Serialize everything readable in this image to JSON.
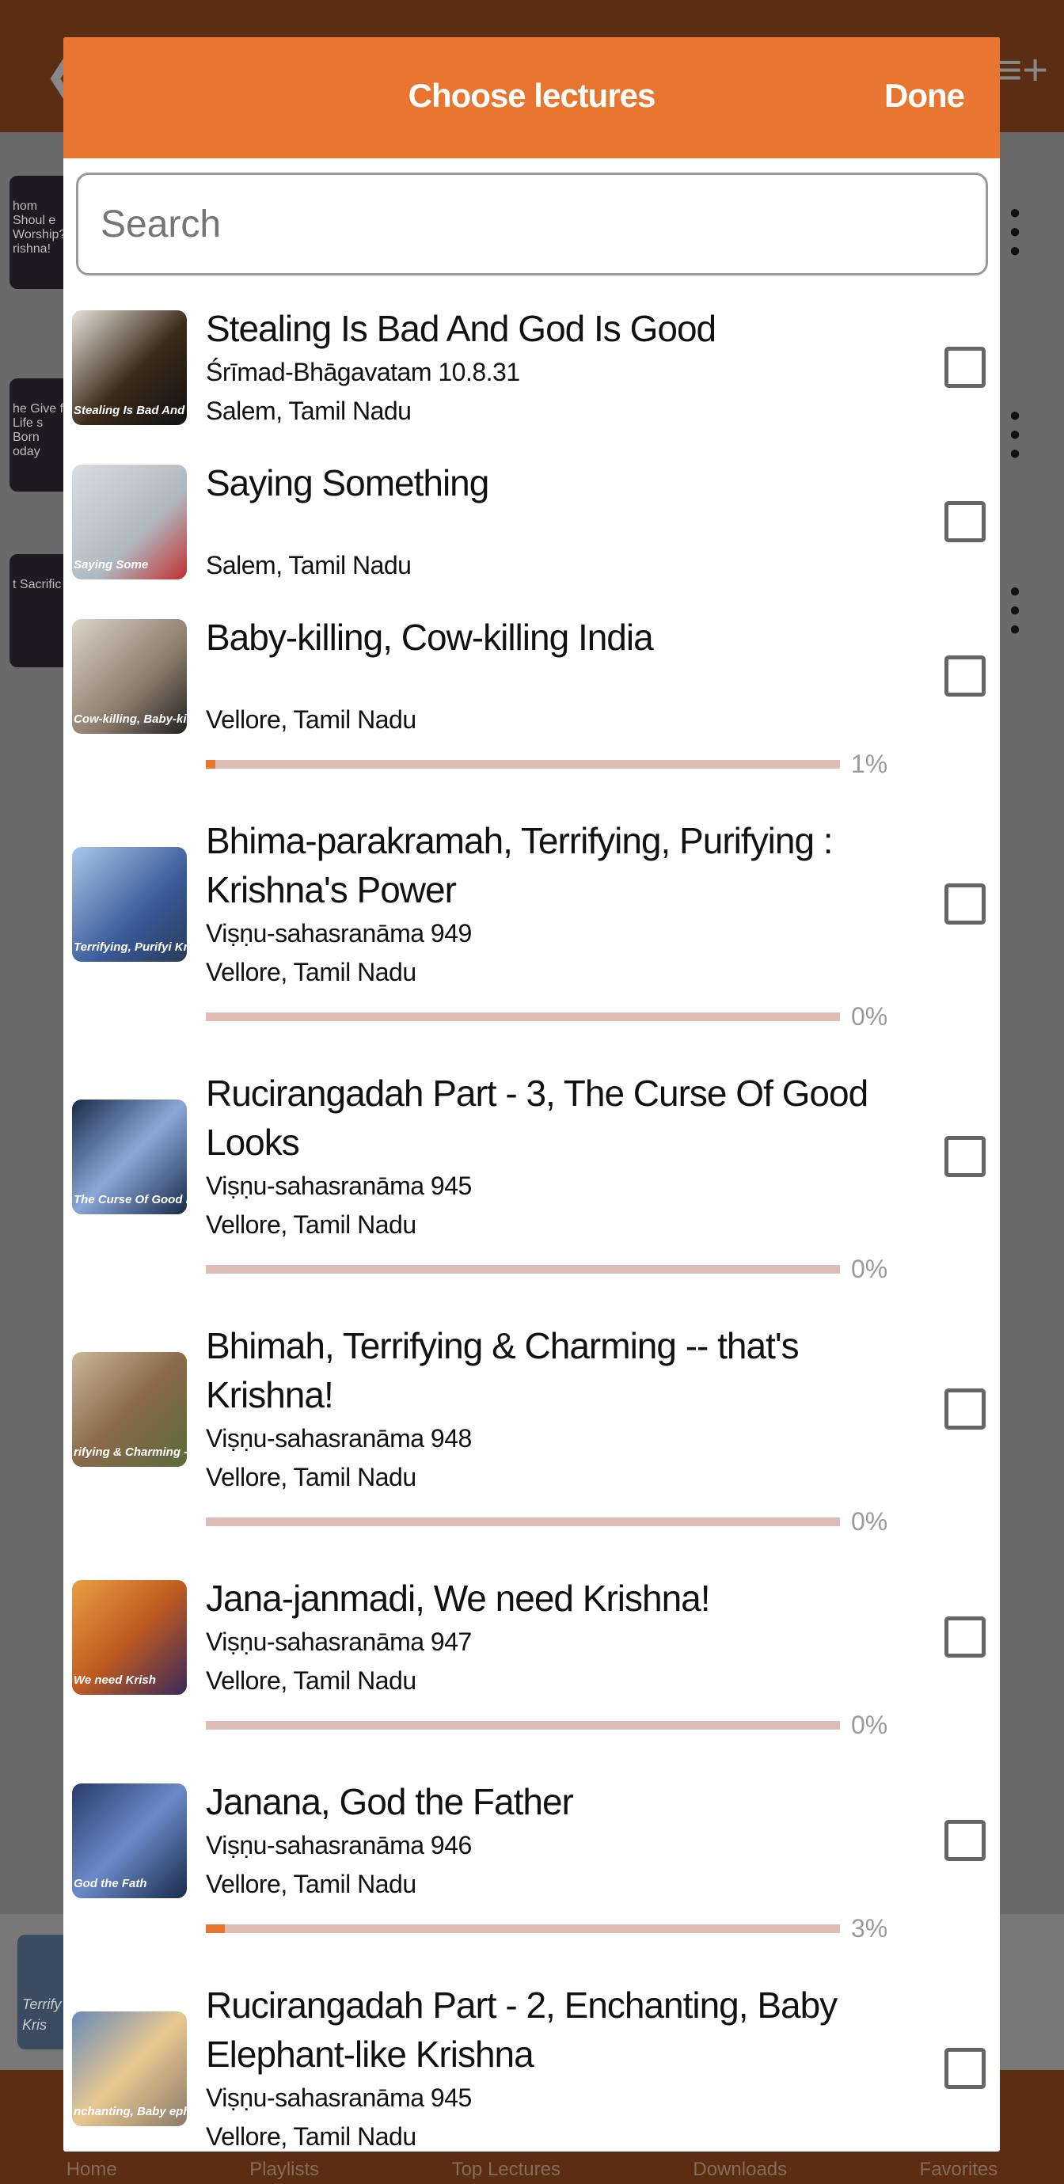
{
  "background": {
    "back_icon": "arrow-left-icon",
    "add_playlist_icon": "playlist-add-icon",
    "rows": [
      {
        "thumb_caption": "hom Shoul e Worship? rishna!"
      },
      {
        "thumb_caption": "he Give f Life s Born oday"
      },
      {
        "thumb_caption": "t Sacrific"
      }
    ],
    "mini_player_caption": "Terrify Kris",
    "nav": [
      "Home",
      "Playlists",
      "Top Lectures",
      "Downloads",
      "Favorites"
    ]
  },
  "dialog": {
    "title": "Choose lectures",
    "done_label": "Done",
    "search_placeholder": "Search",
    "accent": "#e87530",
    "items": [
      {
        "title": "Stealing Is Bad And God Is Good",
        "subtitle": "Śrīmad-Bhāgavatam 10.8.31",
        "location": "Salem, Tamil Nadu",
        "thumb_caption": "Stealing Is Bad And God Is Good",
        "checked": false,
        "progress": null,
        "thumb": "linear-gradient(135deg,#e8e2da,#3b2a1a 55%,#111)"
      },
      {
        "title": "Saying Something",
        "subtitle": "",
        "location": "Salem, Tamil Nadu",
        "thumb_caption": "Saying Some",
        "checked": false,
        "progress": null,
        "thumb": "linear-gradient(135deg,#d8dde2,#b0b8c0 60%,#c03030)"
      },
      {
        "title": "Baby-killing, Cow-killing India",
        "subtitle": "",
        "location": "Vellore, Tamil Nadu",
        "thumb_caption": "Cow-killing, Baby-killing",
        "checked": false,
        "progress": 1,
        "progress_label": "1%",
        "thumb": "linear-gradient(135deg,#ddd4c8,#8a7a6a 60%,#222)"
      },
      {
        "title": "Bhima-parakramah, Terrifying, Purifying : Krishna's Power",
        "subtitle": "Viṣṇu-sahasranāma 949",
        "location": "Vellore, Tamil Nadu",
        "thumb_caption": "Terrifying, Purifyi Krishna's Powe",
        "checked": false,
        "progress": 0,
        "progress_label": "0%",
        "thumb": "linear-gradient(135deg,#a8c8e8,#3a5a9a 60%,#2a3a5a)"
      },
      {
        "title": "Rucirangadah Part - 3, The Curse Of Good Looks",
        "subtitle": "Viṣṇu-sahasranāma 945",
        "location": "Vellore, Tamil Nadu",
        "thumb_caption": "The Curse Of Good L",
        "checked": false,
        "progress": 0,
        "progress_label": "0%",
        "thumb": "linear-gradient(135deg,#1a2a4a,#8aa8d8 50%,#1a2a4a)"
      },
      {
        "title": "Bhimah, Terrifying & Charming -- that's Krishna!",
        "subtitle": "Viṣṇu-sahasranāma 948",
        "location": "Vellore, Tamil Nadu",
        "thumb_caption": "rifying & Charming -- that's",
        "checked": false,
        "progress": 0,
        "progress_label": "0%",
        "thumb": "linear-gradient(135deg,#c8b898,#8a6a4a 50%,#5a6a3a)"
      },
      {
        "title": "Jana-janmadi, We need Krishna!",
        "subtitle": "Viṣṇu-sahasranāma 947",
        "location": "Vellore, Tamil Nadu",
        "thumb_caption": "We need Krish",
        "checked": false,
        "progress": 0,
        "progress_label": "0%",
        "thumb": "linear-gradient(135deg,#e8a040,#c05a20 50%,#3a2a5a)"
      },
      {
        "title": "Janana, God the Father",
        "subtitle": "Viṣṇu-sahasranāma 946",
        "location": "Vellore, Tamil Nadu",
        "thumb_caption": "God the Fath",
        "checked": false,
        "progress": 3,
        "progress_label": "3%",
        "thumb": "linear-gradient(135deg,#2a3a6a,#6a8ac8 50%,#1a2a4a)"
      },
      {
        "title": "Rucirangadah Part - 2, Enchanting, Baby Elephant-like Krishna",
        "subtitle": "Viṣṇu-sahasranāma 945",
        "location": "Vellore, Tamil Nadu",
        "thumb_caption": "nchanting, Baby ephant-like Krishna",
        "checked": false,
        "progress": null,
        "thumb": "linear-gradient(135deg,#6a8ab8,#e8c890 50%,#8a7a6a)"
      }
    ]
  }
}
